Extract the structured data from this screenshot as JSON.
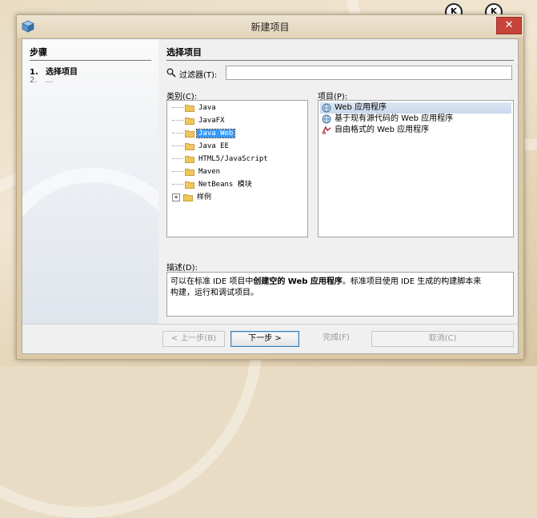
{
  "window": {
    "title": "新建项目",
    "close_label": "✕"
  },
  "steps": {
    "heading": "步骤",
    "items": [
      {
        "num": "1.",
        "label": "选择项目"
      },
      {
        "num": "2.",
        "label": "..."
      }
    ]
  },
  "main": {
    "heading": "选择项目",
    "filter": {
      "label": "过滤器(T):",
      "value": ""
    },
    "categories_label": "类别(C):",
    "categories": [
      {
        "label": "Java"
      },
      {
        "label": "JavaFX"
      },
      {
        "label": "Java Web",
        "selected": true
      },
      {
        "label": "Java EE"
      },
      {
        "label": "HTML5/JavaScript"
      },
      {
        "label": "Maven"
      },
      {
        "label": "NetBeans 模块"
      },
      {
        "label": "样例",
        "expandable": true
      }
    ],
    "projects_label": "项目(P):",
    "projects": [
      {
        "label": "Web 应用程序",
        "icon": "globe-icon",
        "selected": true
      },
      {
        "label": "基于现有源代码的 Web 应用程序",
        "icon": "globe-icon"
      },
      {
        "label": "自由格式的 Web 应用程序",
        "icon": "freeform-icon"
      }
    ],
    "description_label": "描述(D):",
    "description": {
      "line1_pre": "可以在标准 IDE 项目中",
      "line1_bold": "创建空的 Web 应用程序",
      "line1_post": "。标准项目使用 IDE 生成的构建脚本来",
      "line2": "构建，运行和调试项目。"
    }
  },
  "buttons": {
    "back": "< 上一步(B)",
    "next": "下一步 >",
    "finish": "完成(F)",
    "cancel": "取消(C)"
  },
  "colors": {
    "selection": "#3399ff",
    "close": "#c7443a"
  }
}
